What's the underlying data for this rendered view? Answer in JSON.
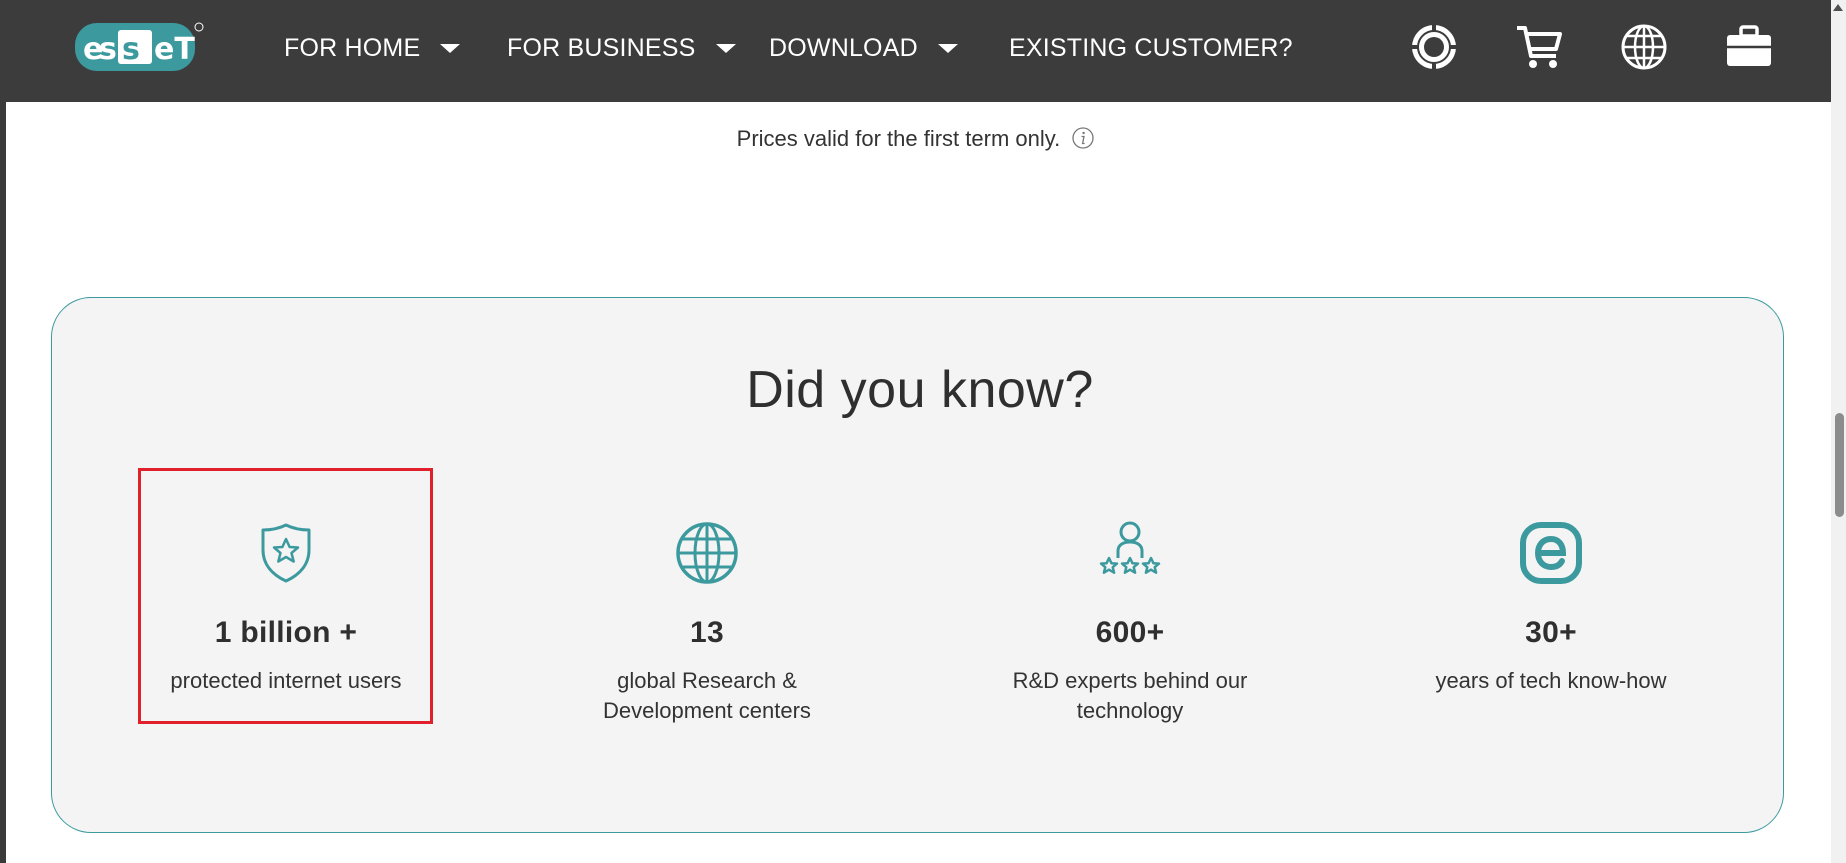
{
  "nav": {
    "items": [
      {
        "label": "FOR HOME",
        "has_dropdown": true
      },
      {
        "label": "FOR BUSINESS",
        "has_dropdown": true
      },
      {
        "label": "DOWNLOAD",
        "has_dropdown": true
      },
      {
        "label": "EXISTING CUSTOMER?",
        "has_dropdown": false
      }
    ],
    "icons": [
      "support-lifebuoy-icon",
      "cart-icon",
      "globe-icon",
      "briefcase-icon"
    ]
  },
  "pricing": {
    "note": "Prices valid for the first term only."
  },
  "did_you_know": {
    "title": "Did you know?",
    "stats": [
      {
        "icon": "shield-star-icon",
        "value": "1 billion +",
        "label": "protected internet users"
      },
      {
        "icon": "globe-icon",
        "value": "13",
        "label": "global Research & Development centers"
      },
      {
        "icon": "experts-stars-icon",
        "value": "600+",
        "label": "R&D experts behind our technology"
      },
      {
        "icon": "eset-e-icon",
        "value": "30+",
        "label": "years of tech know-how"
      }
    ]
  },
  "colors": {
    "navbar_bg": "#3c3c3c",
    "accent_teal": "#3c9a9f",
    "card_bg": "#f4f4f4",
    "highlight_red": "#e0202a"
  }
}
